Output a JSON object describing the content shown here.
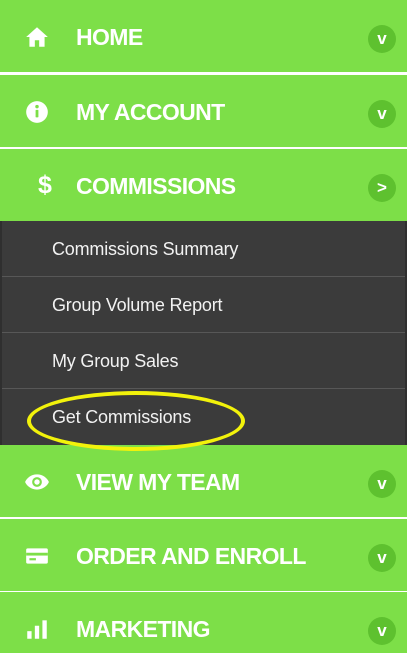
{
  "menu": {
    "items": [
      {
        "label": "HOME",
        "icon": "home-icon",
        "toggle": "v"
      },
      {
        "label": "MY ACCOUNT",
        "icon": "info-icon",
        "toggle": "v"
      },
      {
        "label": "COMMISSIONS",
        "icon": "dollar-icon",
        "toggle": ">"
      },
      {
        "label": "VIEW MY TEAM",
        "icon": "eye-icon",
        "toggle": "v"
      },
      {
        "label": "ORDER AND ENROLL",
        "icon": "credit-card-icon",
        "toggle": "v"
      },
      {
        "label": "MARKETING",
        "icon": "bar-chart-icon",
        "toggle": "v"
      }
    ],
    "commissions_submenu": [
      "Commissions Summary",
      "Group Volume Report",
      "My Group Sales",
      "Get Commissions"
    ],
    "dollar_symbol": "$"
  },
  "colors": {
    "menu_green": "#7ddf48",
    "toggle_green": "#5ec12f",
    "submenu_dark": "#3b3b3b",
    "highlight_yellow": "#f2f20b",
    "text_white": "#ffffff"
  }
}
